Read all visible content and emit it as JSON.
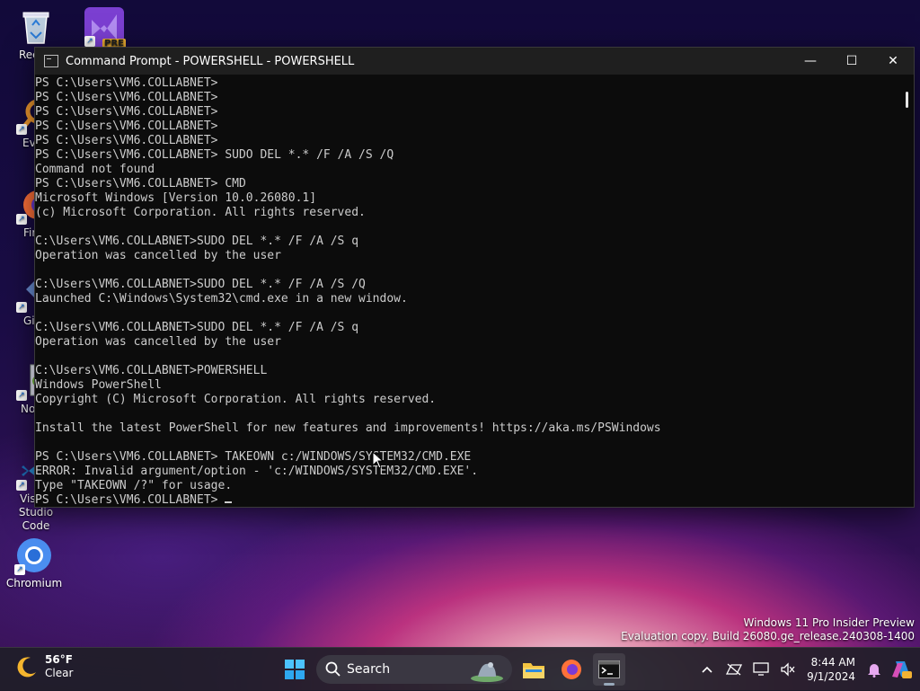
{
  "desktop": {
    "icons": [
      {
        "label": "Recycle Bin"
      },
      {
        "label": "PRE"
      },
      {
        "label": "Everything"
      },
      {
        "label": "Firefox"
      },
      {
        "label": "Git Bash"
      },
      {
        "label": "Notepad++"
      },
      {
        "label": "Visual Studio Code"
      },
      {
        "label": "Chromium"
      }
    ]
  },
  "window": {
    "title": "Command Prompt - POWERSHELL - POWERSHELL",
    "controls": {
      "minimize": "—",
      "maximize": "☐",
      "close": "✕"
    },
    "lines": [
      "PS C:\\Users\\VM6.COLLABNET>",
      "PS C:\\Users\\VM6.COLLABNET>",
      "PS C:\\Users\\VM6.COLLABNET>",
      "PS C:\\Users\\VM6.COLLABNET>",
      "PS C:\\Users\\VM6.COLLABNET>",
      "PS C:\\Users\\VM6.COLLABNET> SUDO DEL *.* /F /A /S /Q",
      "Command not found",
      "PS C:\\Users\\VM6.COLLABNET> CMD",
      "Microsoft Windows [Version 10.0.26080.1]",
      "(c) Microsoft Corporation. All rights reserved.",
      "",
      "C:\\Users\\VM6.COLLABNET>SUDO DEL *.* /F /A /S q",
      "Operation was cancelled by the user",
      "",
      "C:\\Users\\VM6.COLLABNET>SUDO DEL *.* /F /A /S /Q",
      "Launched C:\\Windows\\System32\\cmd.exe in a new window.",
      "",
      "C:\\Users\\VM6.COLLABNET>SUDO DEL *.* /F /A /S q",
      "Operation was cancelled by the user",
      "",
      "C:\\Users\\VM6.COLLABNET>POWERSHELL",
      "Windows PowerShell",
      "Copyright (C) Microsoft Corporation. All rights reserved.",
      "",
      "Install the latest PowerShell for new features and improvements! https://aka.ms/PSWindows",
      "",
      "PS C:\\Users\\VM6.COLLABNET> TAKEOWN c:/WINDOWS/SYSTEM32/CMD.EXE",
      "ERROR: Invalid argument/option - 'c:/WINDOWS/SYSTEM32/CMD.EXE'.",
      "Type \"TAKEOWN /?\" for usage.",
      "PS C:\\Users\\VM6.COLLABNET> "
    ]
  },
  "watermark": {
    "line1": "Windows 11 Pro Insider Preview",
    "line2": "Evaluation copy. Build 26080.ge_release.240308-1400"
  },
  "taskbar": {
    "weather": {
      "temp": "56°F",
      "condition": "Clear"
    },
    "search_label": "Search",
    "clock": {
      "time": "8:44 AM",
      "date": "9/1/2024"
    }
  },
  "colors": {
    "console_bg": "#0c0c0c",
    "console_text": "#cccccc",
    "titlebar": "#1f1f1f"
  }
}
